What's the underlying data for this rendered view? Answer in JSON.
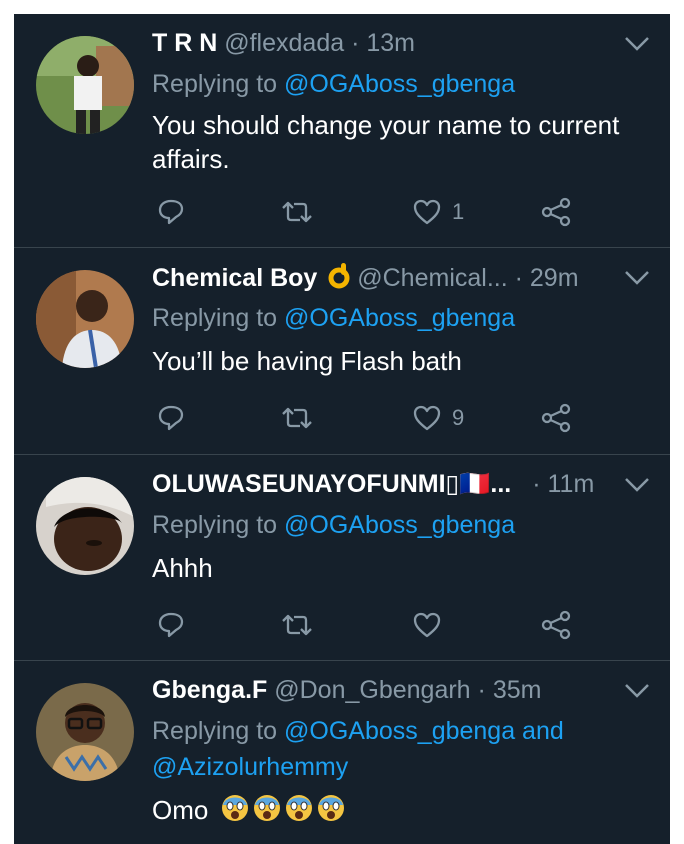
{
  "colors": {
    "background": "#15202b",
    "divider": "#38444d",
    "text_primary": "#ffffff",
    "text_secondary": "#8899a6",
    "link": "#1da1f2"
  },
  "replies": [
    {
      "name": "T R N",
      "handle": "@flexdada",
      "separator": "·",
      "time": "13m",
      "replying_prefix": "Replying to",
      "replying_to": "@OGAboss_gbenga",
      "text": "You should change your name to current affairs.",
      "like_count": "1",
      "icons": [
        "reply-icon",
        "retweet-icon",
        "heart-icon",
        "share-icon"
      ]
    },
    {
      "name": "Chemical Boy",
      "name_emoji": "👌",
      "handle": "@Chemical...",
      "separator": "·",
      "time": "29m",
      "replying_prefix": "Replying to",
      "replying_to": "@OGAboss_gbenga",
      "text": "You’ll be having Flash bath",
      "like_count": "9",
      "icons": [
        "reply-icon",
        "retweet-icon",
        "heart-icon",
        "share-icon"
      ]
    },
    {
      "name": "OLUWASEUNAYOFUNMI▯🇫🇷...",
      "separator": "·",
      "time": "11m",
      "replying_prefix": "Replying to",
      "replying_to": "@OGAboss_gbenga",
      "text": "Ahhh",
      "like_count": "",
      "icons": [
        "reply-icon",
        "retweet-icon",
        "heart-icon",
        "share-icon"
      ]
    },
    {
      "name": "Gbenga.F",
      "handle": "@Don_Gbengarh",
      "separator": "·",
      "time": "35m",
      "replying_prefix": "Replying to",
      "replying_to": "@OGAboss_gbenga and @Azizolurhemmy",
      "text": "Omo",
      "text_emoji": "😱😱😱😱"
    }
  ]
}
